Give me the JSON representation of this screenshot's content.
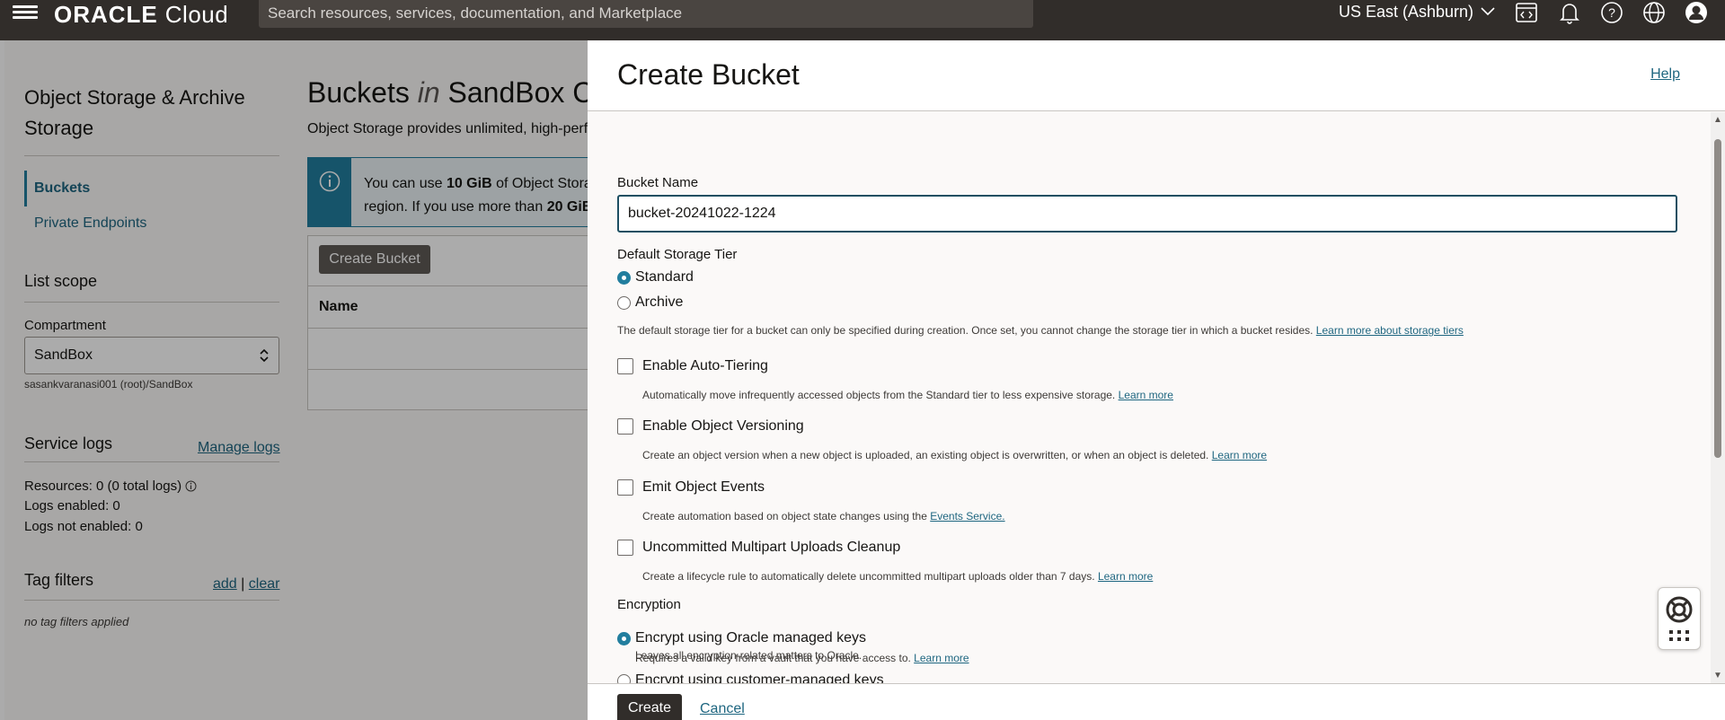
{
  "header": {
    "brand_oracle": "ORACLE",
    "brand_cloud": "Cloud",
    "search_placeholder": "Search resources, services, documentation, and Marketplace",
    "region": "US East (Ashburn)"
  },
  "sidebar": {
    "title": "Object Storage & Archive Storage",
    "items": [
      {
        "label": "Buckets",
        "active": true
      },
      {
        "label": "Private Endpoints",
        "active": false
      }
    ],
    "list_scope": "List scope",
    "compartment_label": "Compartment",
    "compartment_value": "SandBox",
    "compartment_path": "sasankvaranasi001 (root)/SandBox",
    "service_logs": {
      "title": "Service logs",
      "manage": "Manage logs",
      "resources_label": "Resources:",
      "resources_value": "0 (0 total logs)",
      "enabled_label": "Logs enabled:",
      "enabled_value": "0",
      "not_enabled_label": "Logs not enabled:",
      "not_enabled_value": "0"
    },
    "tag_filters": {
      "title": "Tag filters",
      "add": "add",
      "sep": "|",
      "clear": "clear",
      "empty": "no tag filters applied"
    }
  },
  "main": {
    "title_pre": "Buckets",
    "title_in": "in",
    "title_post": "SandBox C",
    "subtitle": "Object Storage provides unlimited, high-perfo",
    "info_line1_pre": "You can use",
    "info_line1_bold": "10 GiB",
    "info_line1_post": "of Object Stora",
    "info_line2_pre": "region. If you use more than",
    "info_line2_bold": "20 GiB",
    "create_button": "Create Bucket",
    "col_name": "Name"
  },
  "drawer": {
    "title": "Create Bucket",
    "help": "Help",
    "bucket_name_label": "Bucket Name",
    "bucket_name_value": "bucket-20241022-1224",
    "storage_tier_label": "Default Storage Tier",
    "tier_options": [
      {
        "label": "Standard",
        "selected": true
      },
      {
        "label": "Archive",
        "selected": false
      }
    ],
    "tier_desc": "The default storage tier for a bucket can only be specified during creation. Once set, you cannot change the storage tier in which a bucket resides.",
    "tier_link": "Learn more about storage tiers",
    "checkboxes": [
      {
        "label": "Enable Auto-Tiering",
        "desc": "Automatically move infrequently accessed objects from the Standard tier to less expensive storage.",
        "link": "Learn more",
        "checked": false
      },
      {
        "label": "Enable Object Versioning",
        "desc": "Create an object version when a new object is uploaded, an existing object is overwritten, or when an object is deleted.",
        "link": "Learn more",
        "checked": false
      },
      {
        "label": "Emit Object Events",
        "desc": "Create automation based on object state changes using the",
        "link": "Events Service.",
        "checked": false
      },
      {
        "label": "Uncommitted Multipart Uploads Cleanup",
        "desc": "Create a lifecycle rule to automatically delete uncommitted multipart uploads older than 7 days.",
        "link": "Learn more",
        "checked": false
      }
    ],
    "encryption_label": "Encryption",
    "encryption_options": [
      {
        "label": "Encrypt using Oracle managed keys",
        "desc": "Leaves all encryption-related matters to Oracle.",
        "link": "",
        "selected": true
      },
      {
        "label": "Encrypt using customer-managed keys",
        "desc": "Requires a valid key from a vault that you have access to.",
        "link": "Learn more",
        "selected": false
      }
    ],
    "create_button": "Create",
    "cancel_button": "Cancel"
  },
  "colors": {
    "header_bg": "#312d2a",
    "accent": "#227e9e",
    "link": "#1e6680"
  }
}
